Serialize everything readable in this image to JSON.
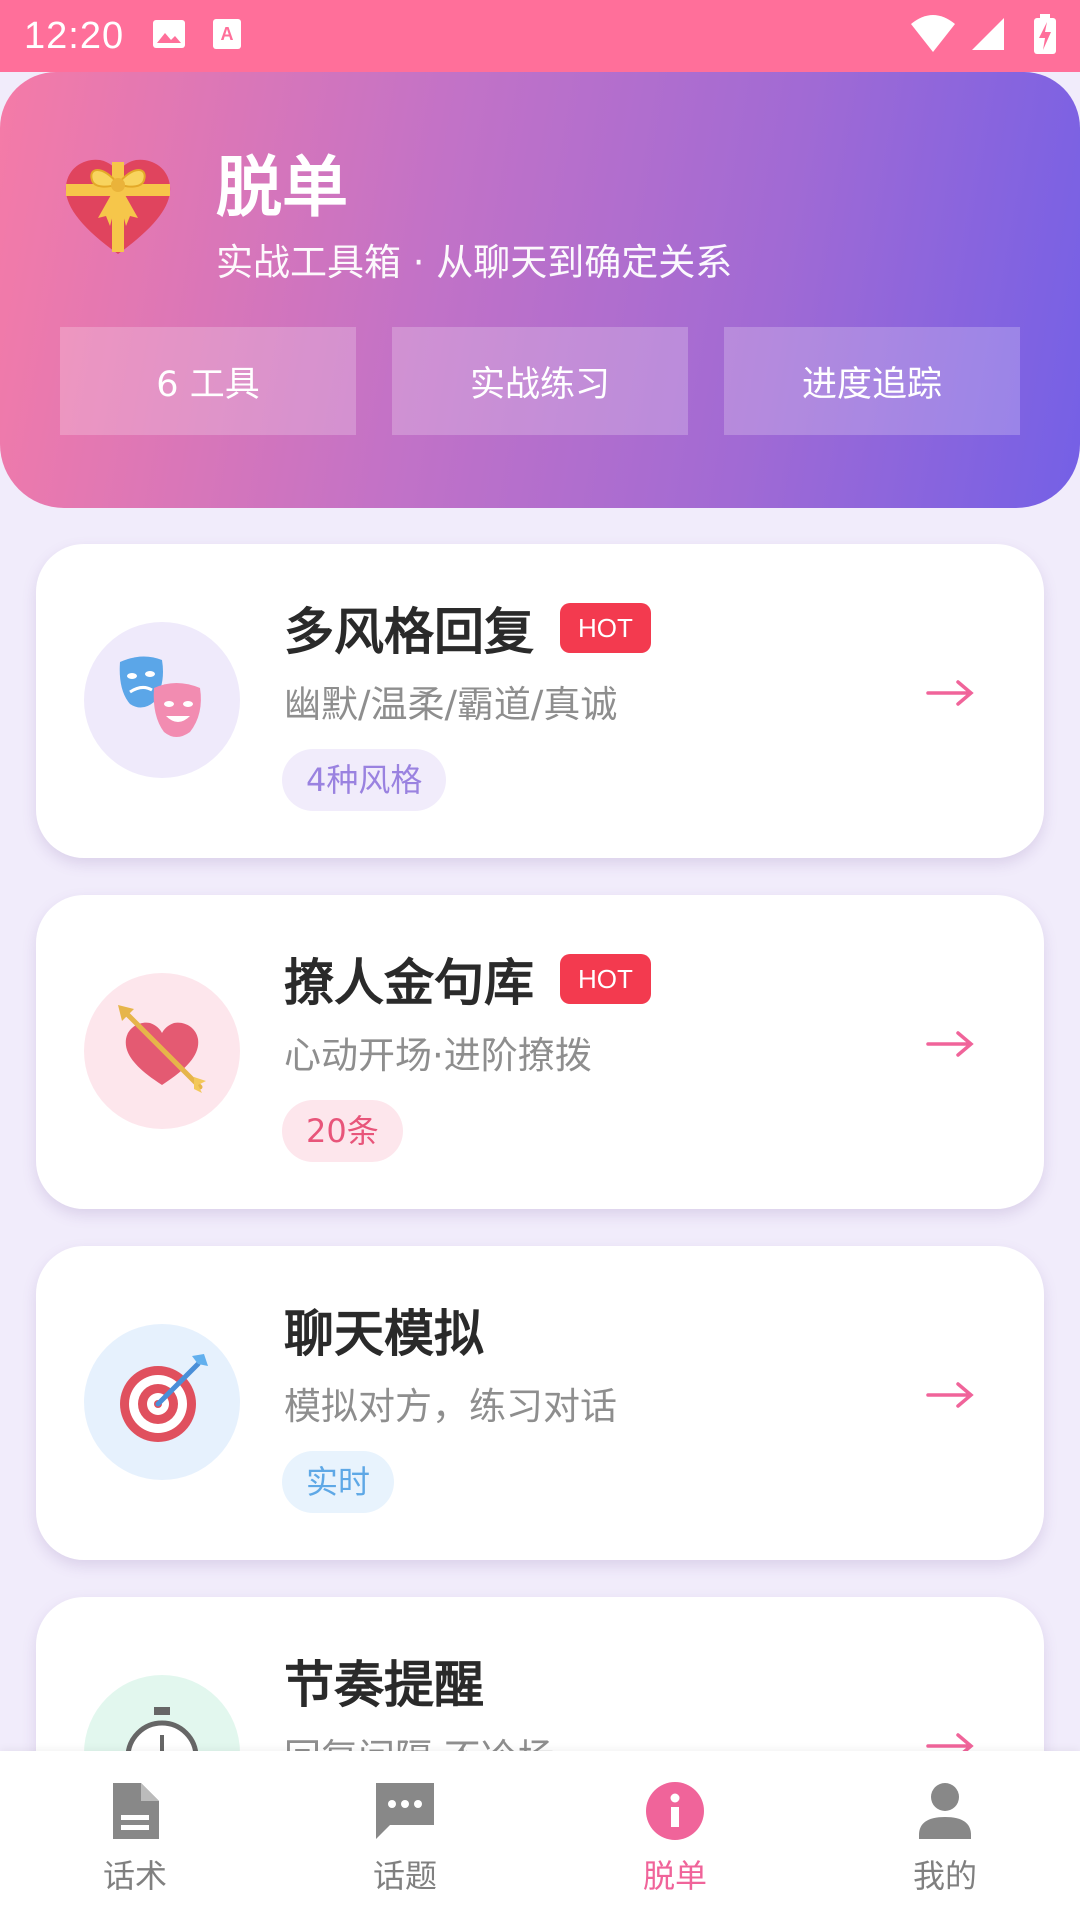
{
  "status_bar": {
    "time": "12:20"
  },
  "header": {
    "title": "脱单",
    "subtitle": "实战工具箱 · 从聊天到确定关系",
    "pills": [
      "6 工具",
      "实战练习",
      "进度追踪"
    ]
  },
  "cards": [
    {
      "title": "多风格回复",
      "badge": "HOT",
      "desc": "幽默/温柔/霸道/真诚",
      "tag": "4种风格",
      "icon": "theater-masks-icon"
    },
    {
      "title": "撩人金句库",
      "badge": "HOT",
      "desc": "心动开场·进阶撩拨",
      "tag": "20条",
      "icon": "heart-arrow-icon"
    },
    {
      "title": "聊天模拟",
      "badge": "",
      "desc": "模拟对方，练习对话",
      "tag": "实时",
      "icon": "target-icon"
    },
    {
      "title": "节奏提醒",
      "badge": "",
      "desc": "回复间隔·不冷场",
      "tag": "",
      "icon": "stopwatch-icon"
    }
  ],
  "colors": {
    "accent": "#f0649a",
    "hot": "#f33a4f",
    "status_bar": "#ff6f9a"
  },
  "bottom_nav": [
    {
      "label": "话术",
      "icon": "document-icon",
      "active": false
    },
    {
      "label": "话题",
      "icon": "chat-icon",
      "active": false
    },
    {
      "label": "脱单",
      "icon": "info-icon",
      "active": true
    },
    {
      "label": "我的",
      "icon": "person-icon",
      "active": false
    }
  ]
}
